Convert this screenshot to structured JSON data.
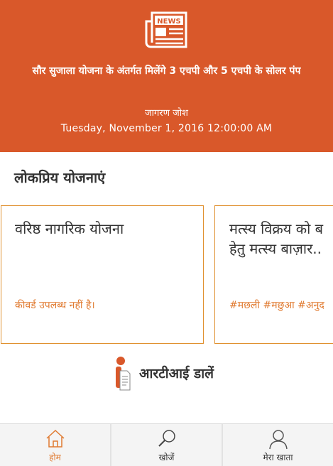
{
  "banner": {
    "headline": "सौर सुजाला योजना के अंतर्गत मिलेंगे 3 एचपी और 5 एचपी के सोलर पंप",
    "source": "जागरण जोश",
    "date": "Tuesday, November 1, 2016 12:00:00 AM",
    "icon_text": "NEWS",
    "color": "#d9582a"
  },
  "section": {
    "title": "लोकप्रिय योजनाएं"
  },
  "cards": [
    {
      "title": "वरिष्ठ नागरिक योजना",
      "meta": "कीवर्ड उपलब्ध नहीं है।"
    },
    {
      "title": "मत्स्य विक्रय को ब",
      "title_line2": "हेतु मत्स्य बाज़ार..",
      "meta": "#मछली #मछुआ #अनुद"
    }
  ],
  "rti": {
    "label": "आरटीआई डालें"
  },
  "tabbar": {
    "home": "होम",
    "search": "खोजें",
    "account": "मेरा खाता"
  },
  "colors": {
    "accent": "#e07a30",
    "banner": "#d9582a"
  }
}
